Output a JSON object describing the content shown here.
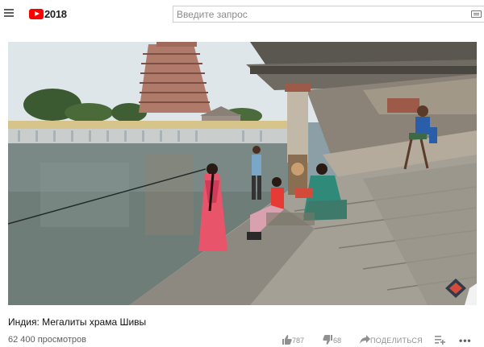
{
  "app": {
    "logo_year": "2018"
  },
  "search": {
    "placeholder": "Введите запрос"
  },
  "video": {
    "title": "Индия: Мегалиты храма Шивы",
    "views": "62 400 просмотров",
    "likes": "787",
    "dislikes": "68",
    "share_label": "ПОДЕЛИТЬСЯ",
    "more_label": "•••"
  },
  "icons": {
    "menu": "hamburger-icon",
    "logo": "youtube-logo-icon",
    "keyboard": "keyboard-icon",
    "like": "thumbs-up-icon",
    "dislike": "thumbs-down-icon",
    "share": "share-arrow-icon",
    "add": "add-to-playlist-icon",
    "more": "more-dots-icon"
  },
  "colors": {
    "brand": "#ff0000",
    "text_primary": "#111111",
    "text_secondary": "#606060",
    "action_grey": "#909090"
  }
}
